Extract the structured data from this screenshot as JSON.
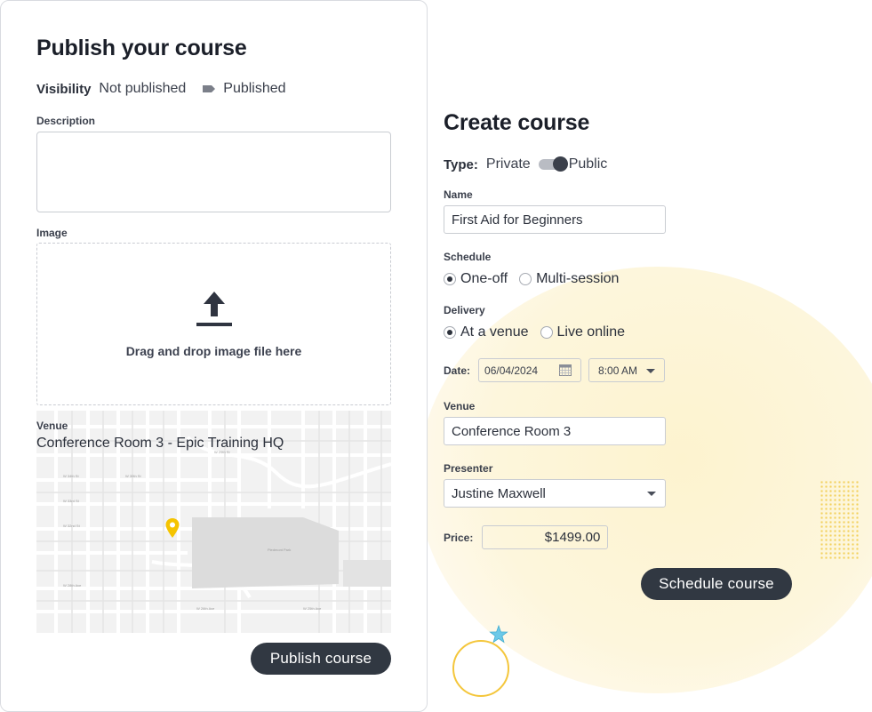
{
  "publish_card": {
    "title": "Publish your course",
    "visibility": {
      "label": "Visibility",
      "option_off": "Not published",
      "option_on": "Published"
    },
    "description": {
      "label": "Description",
      "value": ""
    },
    "image": {
      "label": "Image",
      "dropzone_text": "Drag and drop image file here",
      "icon": "upload-icon"
    },
    "venue": {
      "label": "Venue",
      "value": "Conference Room 3 - Epic Training HQ",
      "marker_icon": "map-pin-icon"
    },
    "publish_button": "Publish course"
  },
  "create_course": {
    "title": "Create course",
    "type": {
      "label": "Type:",
      "option_left": "Private",
      "option_right": "Public",
      "selected": "Public"
    },
    "name": {
      "label": "Name",
      "value": "First Aid for Beginners"
    },
    "schedule": {
      "label": "Schedule",
      "options": [
        "One-off",
        "Multi-session"
      ],
      "selected": "One-off"
    },
    "delivery": {
      "label": "Delivery",
      "options": [
        "At a venue",
        "Live online"
      ],
      "selected": "At a venue"
    },
    "date": {
      "label": "Date:",
      "value": "06/04/2024",
      "time": "8:00 AM"
    },
    "venue": {
      "label": "Venue",
      "value": "Conference Room 3"
    },
    "presenter": {
      "label": "Presenter",
      "value": "Justine Maxwell"
    },
    "price": {
      "label": "Price:",
      "value": "$1499.00"
    },
    "schedule_button": "Schedule course"
  },
  "colors": {
    "button_bg": "#313842",
    "accent_yellow": "#f4c63b",
    "accent_star": "#6cc9e8",
    "pin": "#f5c400"
  }
}
